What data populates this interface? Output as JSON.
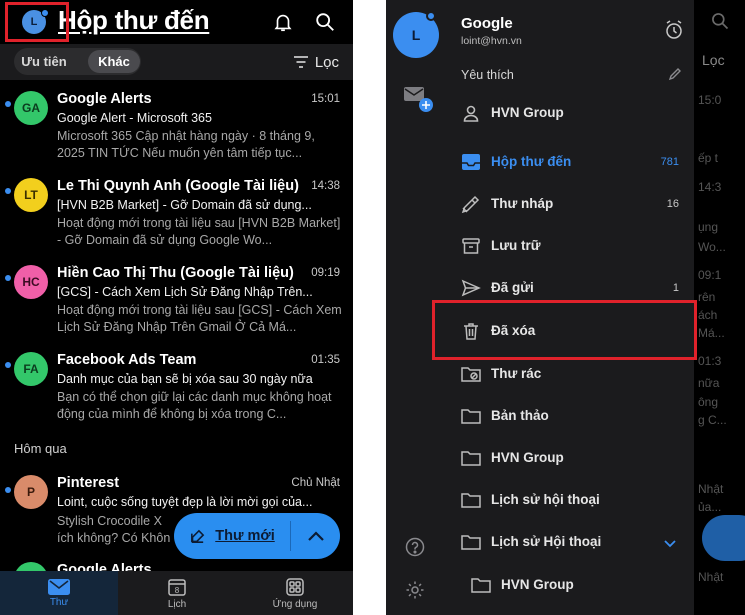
{
  "left": {
    "avatar_initial": "L",
    "title": "Hộp thư đến",
    "icons": {
      "bell": "bell-icon",
      "search": "search-icon",
      "filter": "filter-icon"
    },
    "tabs": {
      "focused": "Ưu tiên",
      "other": "Khác"
    },
    "filter_label": "Lọc",
    "section_yesterday": "Hôm qua",
    "messages": [
      {
        "initials": "GA",
        "color": "#33c76a",
        "sender": "Google Alerts",
        "time": "15:01",
        "subject": "Google Alert - Microsoft 365",
        "preview": "Microsoft 365 Cập nhật hàng ngày · 8 tháng 9, 2025 TIN TỨC Nếu muốn yên tâm tiếp tục..."
      },
      {
        "initials": "LT",
        "color": "#f2cf1d",
        "sender": "Le Thi Quynh Anh (Google Tài liệu)",
        "time": "14:38",
        "subject": "[HVN B2B Market] - Gỡ Domain đã sử dụng...",
        "preview": "Hoạt động mới trong tài liệu sau [HVN B2B Market] - Gỡ Domain đã sử dụng Google Wo..."
      },
      {
        "initials": "HC",
        "color": "#f05fa8",
        "sender": "Hiền Cao Thị Thu (Google Tài liệu)",
        "time": "09:19",
        "subject": "[GCS] - Cách Xem Lịch Sử Đăng Nhập Trên...",
        "preview": "Hoạt động mới trong tài liệu sau [GCS] - Cách Xem Lịch Sử Đăng Nhập Trên Gmail Ở Cả Má..."
      },
      {
        "initials": "FA",
        "color": "#33c76a",
        "sender": "Facebook Ads Team",
        "time": "01:35",
        "subject": "Danh mục của bạn sẽ bị xóa sau 30 ngày nữa",
        "preview": "Bạn có thể chọn giữ lại các danh mục không hoạt động của mình để không bị xóa trong C..."
      },
      {
        "initials": "P",
        "color": "#d98b6a",
        "sender": "Pinterest",
        "time": "Chủ Nhật",
        "subject": "Loint, cuộc sống tuyệt đẹp là lời mời gọi của...",
        "preview": "Stylish Crocodile X ích không? Có Khôn"
      },
      {
        "initials": "GA",
        "color": "#33c76a",
        "sender": "Google Alerts",
        "time": "",
        "subject": "",
        "preview": ""
      }
    ],
    "compose_label": "Thư mới",
    "bottom_tabs": [
      {
        "label": "Thư",
        "icon": "mail-icon"
      },
      {
        "label": "Lịch",
        "icon": "calendar-icon",
        "day": "8"
      },
      {
        "label": "Ứng dụng",
        "icon": "apps-icon"
      }
    ]
  },
  "right": {
    "avatar_initial": "L",
    "account_name": "Google",
    "account_email": "loint@hvn.vn",
    "favorites_label": "Yêu thích",
    "folders": [
      {
        "label": "HVN Group",
        "icon": "person-icon",
        "count": ""
      },
      {
        "label": "Hộp thư đến",
        "icon": "inbox-icon",
        "count": "781",
        "active": true
      },
      {
        "label": "Thư nháp",
        "icon": "draft-pen-icon",
        "count": "16"
      },
      {
        "label": "Lưu trữ",
        "icon": "archive-icon",
        "count": ""
      },
      {
        "label": "Đã gửi",
        "icon": "send-icon",
        "count": "1"
      },
      {
        "label": "Đã xóa",
        "icon": "trash-icon",
        "count": ""
      },
      {
        "label": "Thư rác",
        "icon": "junk-folder-icon",
        "count": ""
      },
      {
        "label": "Bản thảo",
        "icon": "folder-icon",
        "count": ""
      },
      {
        "label": "HVN Group",
        "icon": "folder-icon",
        "count": ""
      },
      {
        "label": "Lịch sử hội thoại",
        "icon": "folder-icon",
        "count": ""
      },
      {
        "label": "Lịch sử Hội thoại",
        "icon": "folder-icon",
        "count": "",
        "expanded": true
      },
      {
        "label": "HVN Group",
        "icon": "folder-icon",
        "count": "",
        "indent": true
      }
    ],
    "behind_text": [
      "15:0",
      "ếp t",
      "14:3",
      "ụng",
      "Wo...",
      "09:1",
      "rên",
      "ách",
      "Má...",
      "01:3",
      "nữa",
      "ông",
      "g C...",
      "Nhật",
      "ủa...",
      "Nhật"
    ],
    "behind_filter": "Lọc"
  }
}
